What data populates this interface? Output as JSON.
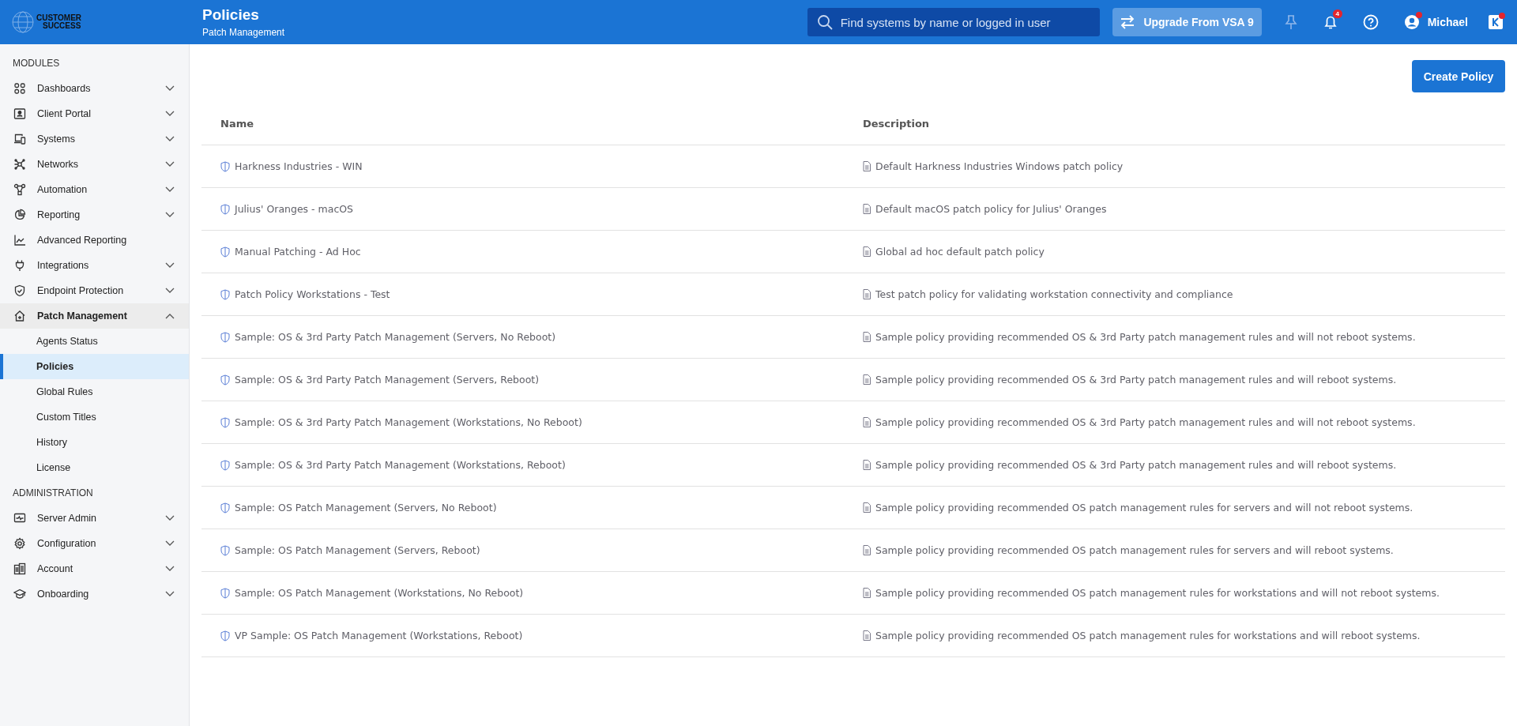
{
  "logo": {
    "line_1": "CUSTOMER",
    "line_2": "SUCCESS"
  },
  "header": {
    "title": "Policies",
    "subtitle": "Patch Management"
  },
  "search": {
    "placeholder": "Find systems by name or logged in user"
  },
  "upgrade_button": "Upgrade From VSA 9",
  "notifications": {
    "count": "4"
  },
  "user": {
    "name": "Michael"
  },
  "sidebar": {
    "sections": [
      {
        "title": "MODULES",
        "items": [
          {
            "kind": "group",
            "label": "Dashboards",
            "expanded": false
          },
          {
            "kind": "group",
            "label": "Client Portal",
            "expanded": false
          },
          {
            "kind": "group",
            "label": "Systems",
            "expanded": false
          },
          {
            "kind": "group",
            "label": "Networks",
            "expanded": false
          },
          {
            "kind": "group",
            "label": "Automation",
            "expanded": false
          },
          {
            "kind": "group",
            "label": "Reporting",
            "expanded": false
          },
          {
            "kind": "link",
            "label": "Advanced Reporting"
          },
          {
            "kind": "group",
            "label": "Integrations",
            "expanded": false
          },
          {
            "kind": "group",
            "label": "Endpoint Protection",
            "expanded": false
          },
          {
            "kind": "group",
            "label": "Patch Management",
            "expanded": true,
            "children": [
              {
                "label": "Agents Status",
                "selected": false
              },
              {
                "label": "Policies",
                "selected": true
              },
              {
                "label": "Global Rules",
                "selected": false
              },
              {
                "label": "Custom Titles",
                "selected": false
              },
              {
                "label": "History",
                "selected": false
              },
              {
                "label": "License",
                "selected": false
              }
            ]
          }
        ]
      },
      {
        "title": "ADMINISTRATION",
        "items": [
          {
            "kind": "group",
            "label": "Server Admin",
            "expanded": false
          },
          {
            "kind": "group",
            "label": "Configuration",
            "expanded": false
          },
          {
            "kind": "group",
            "label": "Account",
            "expanded": false
          },
          {
            "kind": "group",
            "label": "Onboarding",
            "expanded": false
          }
        ]
      }
    ]
  },
  "create_button": "Create Policy",
  "table": {
    "columns": [
      "Name",
      "Description"
    ],
    "rows": [
      {
        "name": "Harkness Industries - WIN",
        "description": "Default Harkness Industries Windows patch policy"
      },
      {
        "name": "Julius' Oranges - macOS",
        "description": "Default macOS patch policy for Julius' Oranges"
      },
      {
        "name": "Manual Patching - Ad Hoc",
        "description": "Global ad hoc default patch policy"
      },
      {
        "name": "Patch Policy Workstations - Test",
        "description": "Test patch policy for validating workstation connectivity and compliance"
      },
      {
        "name": "Sample: OS & 3rd Party Patch Management (Servers, No Reboot)",
        "description": "Sample policy providing recommended OS & 3rd Party patch management rules and will not reboot systems."
      },
      {
        "name": "Sample: OS & 3rd Party Patch Management (Servers, Reboot)",
        "description": "Sample policy providing recommended OS & 3rd Party patch management rules and will reboot systems."
      },
      {
        "name": "Sample: OS & 3rd Party Patch Management (Workstations, No Reboot)",
        "description": "Sample policy providing recommended OS & 3rd Party patch management rules and will not reboot systems."
      },
      {
        "name": "Sample: OS & 3rd Party Patch Management (Workstations, Reboot)",
        "description": "Sample policy providing recommended OS & 3rd Party patch management rules and will reboot systems."
      },
      {
        "name": "Sample: OS Patch Management (Servers, No Reboot)",
        "description": "Sample policy providing recommended OS patch management rules for servers and will not reboot systems."
      },
      {
        "name": "Sample: OS Patch Management (Servers, Reboot)",
        "description": "Sample policy providing recommended OS patch management rules for servers and will reboot systems."
      },
      {
        "name": "Sample: OS Patch Management (Workstations, No Reboot)",
        "description": "Sample policy providing recommended OS patch management rules for workstations and will not reboot systems."
      },
      {
        "name": "VP Sample: OS Patch Management (Workstations, Reboot)",
        "description": "Sample policy providing recommended OS patch management rules for workstations and will reboot systems."
      }
    ]
  }
}
